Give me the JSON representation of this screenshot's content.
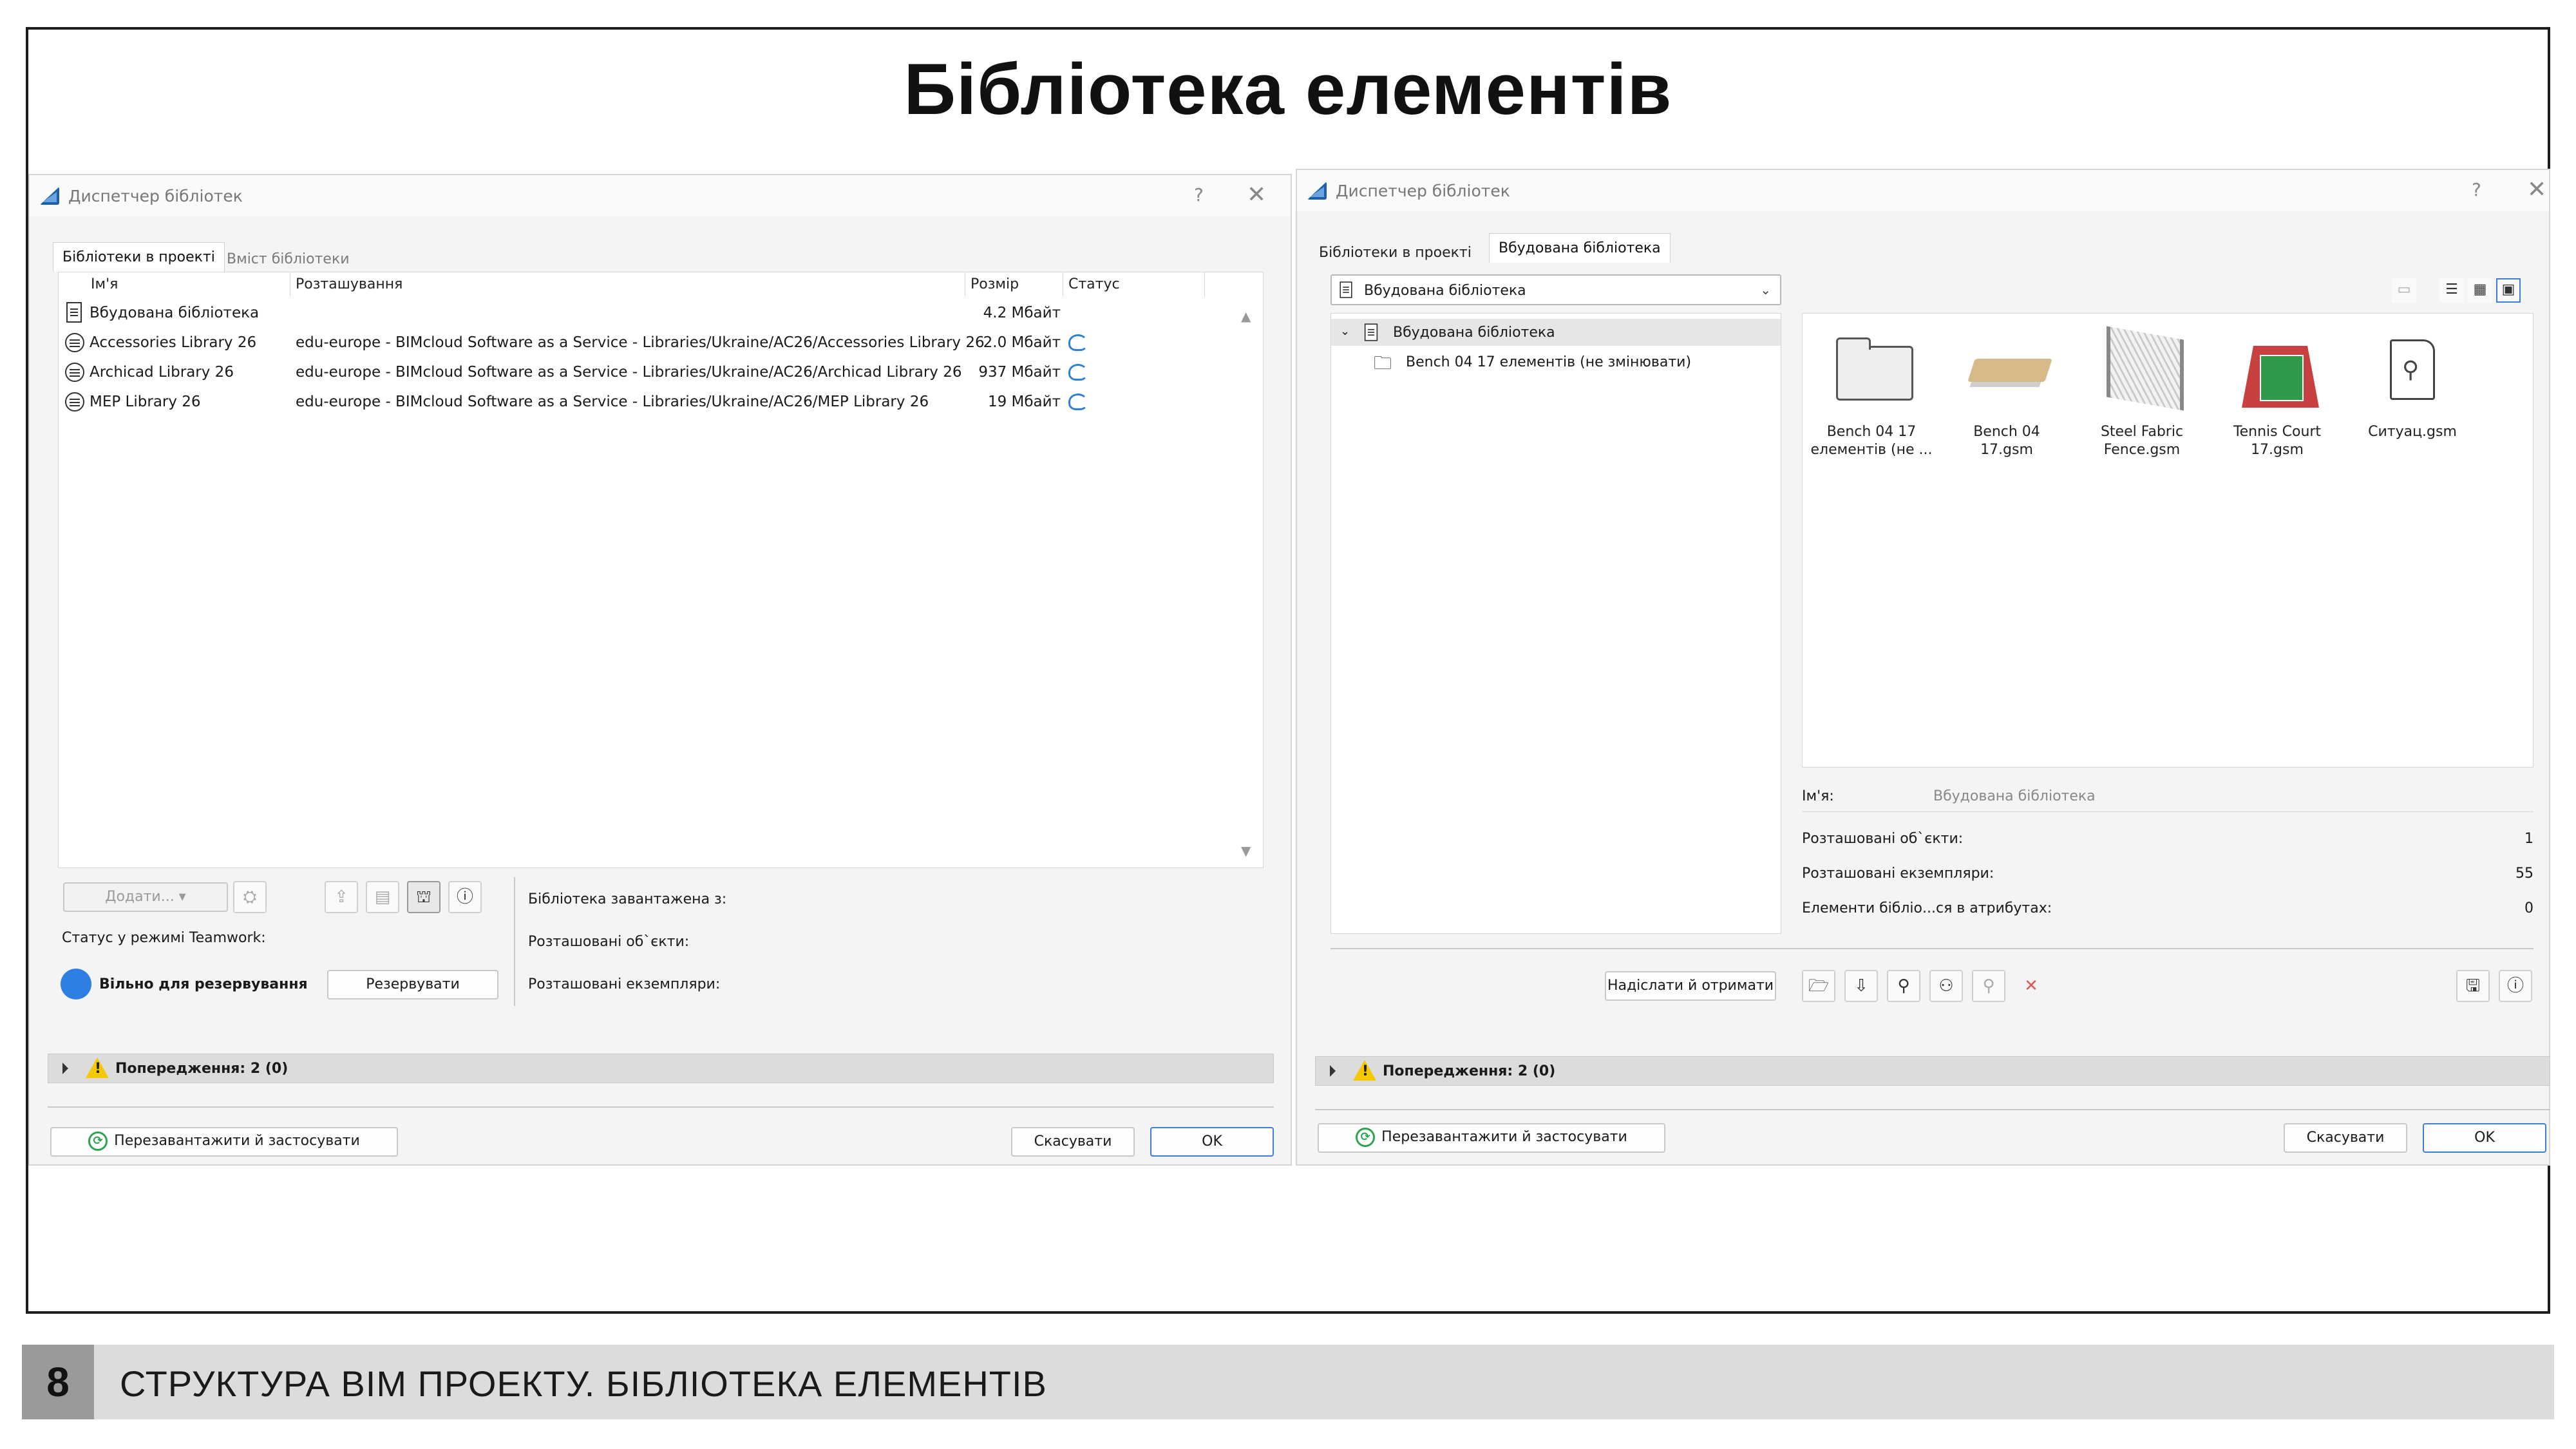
{
  "slide": {
    "title": "Бібліотека елементів",
    "footer_number": "8",
    "footer_text": "СТРУКТУРА ВІМ ПРОЕКТУ. БІБЛІОТЕКА ЕЛЕМЕНТІВ"
  },
  "left_dialog": {
    "title": "Диспетчер бібліотек",
    "help": "?",
    "close": "✕",
    "tabs": [
      "Бібліотеки в проекті",
      "Вміст бібліотеки"
    ],
    "columns": {
      "name": "Ім'я",
      "location": "Розташування",
      "size": "Розмір",
      "status": "Статус"
    },
    "rows": [
      {
        "name": "Вбудована бібліотека",
        "location": "",
        "size": "4.2 Мбайт",
        "icon": "document-icon",
        "cloud": false
      },
      {
        "name": "Accessories Library 26",
        "location": "edu-europe - BIMcloud Software as a Service - Libraries/Ukraine/AC26/Accessories Library 26",
        "size": "2.0 Мбайт",
        "icon": "library-icon",
        "cloud": true
      },
      {
        "name": "Archicad Library 26",
        "location": "edu-europe - BIMcloud Software as a Service - Libraries/Ukraine/AC26/Archicad Library 26",
        "size": "937 Мбайт",
        "icon": "library-icon",
        "cloud": true
      },
      {
        "name": "MEP Library 26",
        "location": "edu-europe - BIMcloud Software as a Service - Libraries/Ukraine/AC26/MEP Library 26",
        "size": "19 Мбайт",
        "icon": "library-icon",
        "cloud": true
      }
    ],
    "add_button": "Додати...",
    "teamwork_label": "Статус у режимі Teamwork:",
    "status_text": "Вільно для резервування",
    "reserve_button": "Резервувати",
    "info_loaded": "Бібліотека завантажена з:",
    "info_objects": "Розташовані об`єкти:",
    "info_instances": "Розташовані екземпляри:",
    "warnings": "Попередження: 2 (0)",
    "reload_button": "Перезавантажити й застосувати",
    "cancel_button": "Скасувати",
    "ok_button": "OK"
  },
  "right_dialog": {
    "title": "Диспетчер бібліотек",
    "help": "?",
    "close": "✕",
    "tabs": [
      "Бібліотеки в проекті",
      "Вбудована бібліотека"
    ],
    "dropdown_value": "Вбудована бібліотека",
    "tree": [
      {
        "label": "Вбудована бібліотека",
        "expanded": true
      },
      {
        "label": "Bench 04 17 елементів (не змінювати)",
        "expanded": false
      }
    ],
    "thumbnails": [
      {
        "caption": "Bench 04 17\nелементів (не ...",
        "icon": "folder-icon"
      },
      {
        "caption": "Bench 04 17.gsm",
        "icon": "bench-icon"
      },
      {
        "caption": "Steel Fabric\nFence.gsm",
        "icon": "fence-icon"
      },
      {
        "caption": "Tennis Court\n17.gsm",
        "icon": "tennis-court-icon"
      },
      {
        "caption": "Ситуац.gsm",
        "icon": "document-icon"
      }
    ],
    "name_label": "Ім'я:",
    "name_value": "Вбудована бібліотека",
    "placed_objects_label": "Розташовані об`єкти:",
    "placed_objects_value": "1",
    "placed_instances_label": "Розташовані екземпляри:",
    "placed_instances_value": "55",
    "attr_elements_label": "Елементи бібліо...ся в атрибутах:",
    "attr_elements_value": "0",
    "send_receive_button": "Надіслати й отримати",
    "warnings": "Попередження: 2 (0)",
    "reload_button": "Перезавантажити й застосувати",
    "cancel_button": "Скасувати",
    "ok_button": "OK"
  },
  "colors": {
    "accent": "#3d7fd1",
    "status_dot": "#2f7fe3",
    "warning": "#f5c800",
    "refresh": "#2ea44f",
    "delete": "#e05a5a"
  }
}
